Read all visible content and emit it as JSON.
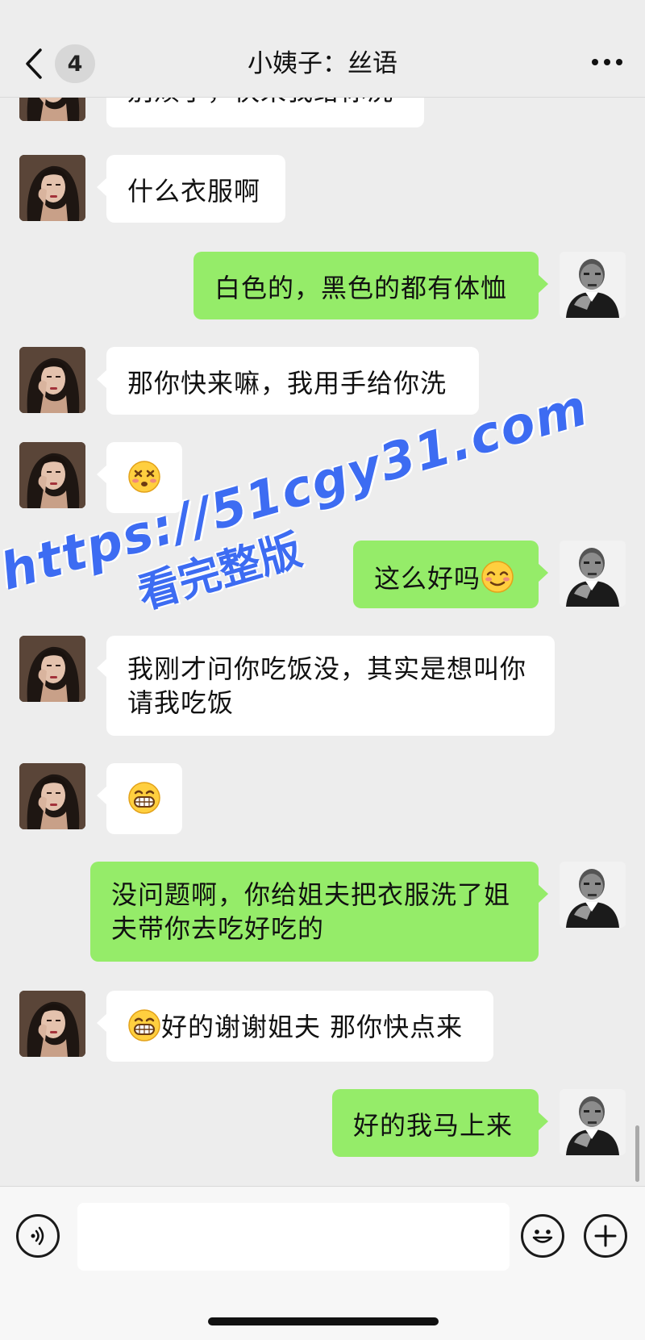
{
  "header": {
    "back_icon": "chevron-left-icon",
    "unread_count": "4",
    "title": "小姨子：丝语",
    "more_icon": "ellipsis-icon"
  },
  "messages": [
    {
      "side": "in",
      "text": "别烦了，快来我给你洗"
    },
    {
      "side": "in",
      "text": "什么衣服啊"
    },
    {
      "side": "out",
      "text": "白色的，黑色的都有体恤"
    },
    {
      "side": "in",
      "text": "那你快来嘛，我用手给你洗"
    },
    {
      "side": "in",
      "emoji": "dizzy-face-emoji"
    },
    {
      "side": "out",
      "text": "这么好吗",
      "emoji_after": "relieved-face-emoji"
    },
    {
      "side": "in",
      "text_line1": "我刚才问你吃饭没，其实是想叫你",
      "text_line2": "请我吃饭"
    },
    {
      "side": "in",
      "emoji": "grinning-face-emoji"
    },
    {
      "side": "out",
      "text_line1": "没问题啊，你给姐夫把衣服洗了姐",
      "text_line2": "夫带你去吃好吃的"
    },
    {
      "side": "in",
      "emoji_before": "grinning-face-emoji",
      "text": "好的谢谢姐夫 那你快点来"
    },
    {
      "side": "out",
      "text": "好的我马上来"
    }
  ],
  "watermark": {
    "line1": "https://51cgy31.com",
    "line2": "看完整版"
  },
  "input_bar": {
    "voice_icon": "voice-icon",
    "emoji_icon": "smiley-icon",
    "plus_icon": "plus-icon",
    "placeholder": ""
  },
  "colors": {
    "background": "#ededed",
    "outgoing_bubble": "#95ec69",
    "incoming_bubble": "#ffffff",
    "watermark": "#3d6cf2"
  }
}
